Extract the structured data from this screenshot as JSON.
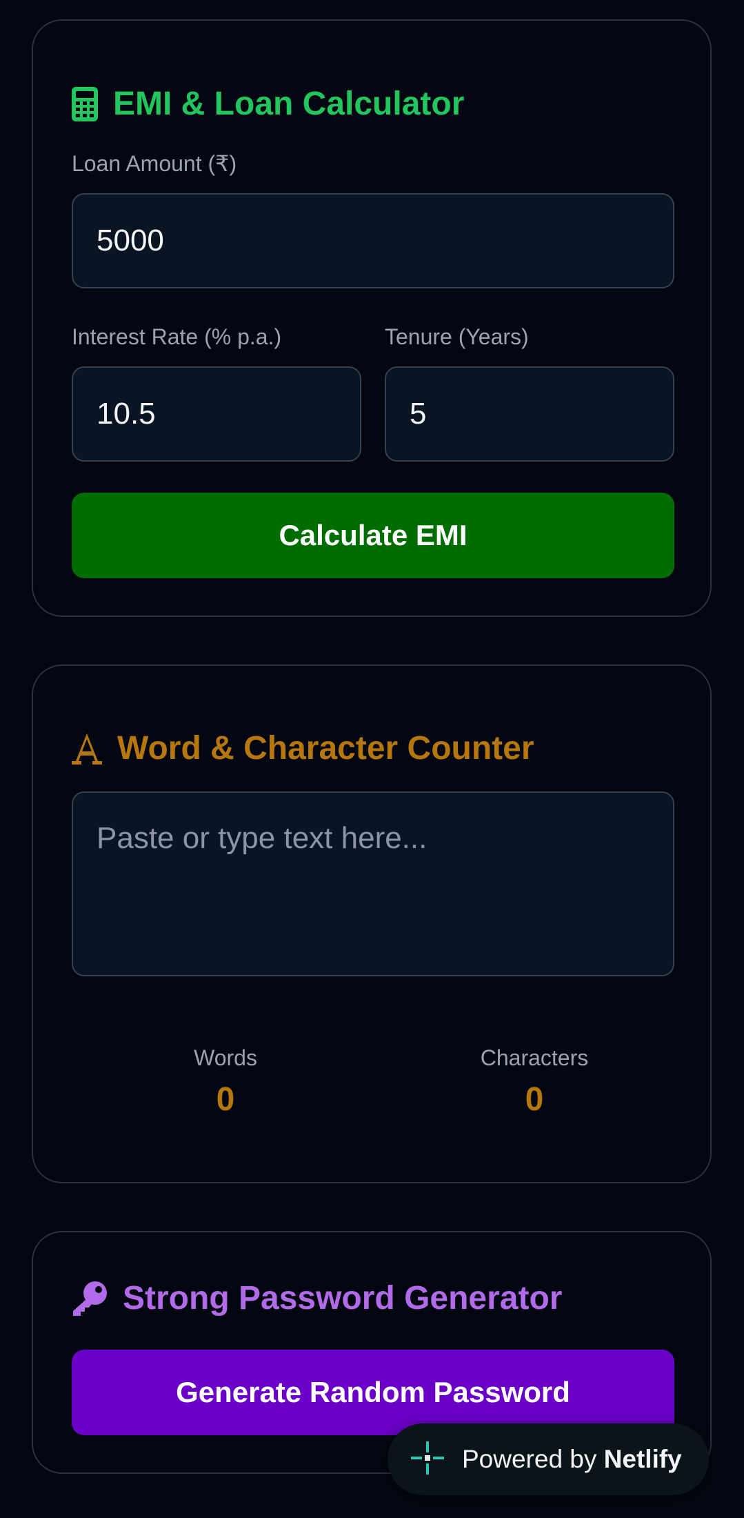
{
  "emi_card": {
    "title": "EMI & Loan Calculator",
    "icon": "calculator-icon",
    "color": "#22c55e",
    "loan_amount_label": "Loan Amount (₹)",
    "loan_amount_value": "5000",
    "interest_rate_label": "Interest Rate (% p.a.)",
    "interest_rate_value": "10.5",
    "tenure_label": "Tenure (Years)",
    "tenure_value": "5",
    "calculate_label": "Calculate EMI",
    "button_color": "#006d00"
  },
  "counter_card": {
    "title": "Word & Character Counter",
    "icon": "font-icon",
    "color": "#b7770f",
    "text_placeholder": "Paste or type text here...",
    "words_label": "Words",
    "words_value": "0",
    "characters_label": "Characters",
    "characters_value": "0"
  },
  "password_card": {
    "title": "Strong Password Generator",
    "icon": "key-icon",
    "color": "#b26be8",
    "generate_label": "Generate Random Password",
    "button_color": "#6b00c8"
  },
  "badge": {
    "icon": "netlify-icon",
    "prefix": "Powered by",
    "brand": "Netlify"
  }
}
